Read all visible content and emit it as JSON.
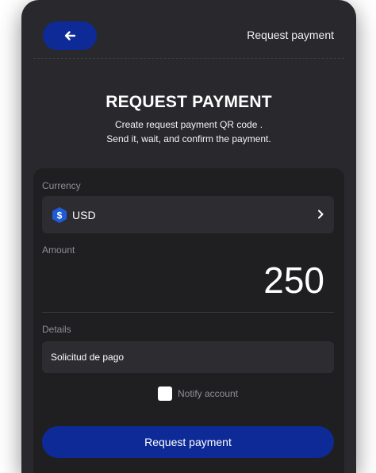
{
  "header": {
    "back_icon": "arrow-left-icon",
    "title": "Request payment"
  },
  "hero": {
    "title": "REQUEST PAYMENT",
    "subtitle_line1": "Create request payment QR code .",
    "subtitle_line2": "Send it, wait, and confirm the payment."
  },
  "form": {
    "currency": {
      "label": "Currency",
      "value": "USD",
      "icon": "dollar-coin-icon",
      "chevron_icon": "chevron-right-icon"
    },
    "amount": {
      "label": "Amount",
      "value": "250"
    },
    "details": {
      "label": "Details",
      "value": "Solicitud de pago"
    },
    "notify": {
      "label": "Notify account",
      "checked": false
    },
    "submit_label": "Request payment"
  },
  "colors": {
    "background": "#29292d",
    "card": "#1f1f22",
    "field": "#2d2d31",
    "accent": "#0d2a96",
    "coin": "#1e5bd8",
    "muted_text": "#8e8e96"
  }
}
